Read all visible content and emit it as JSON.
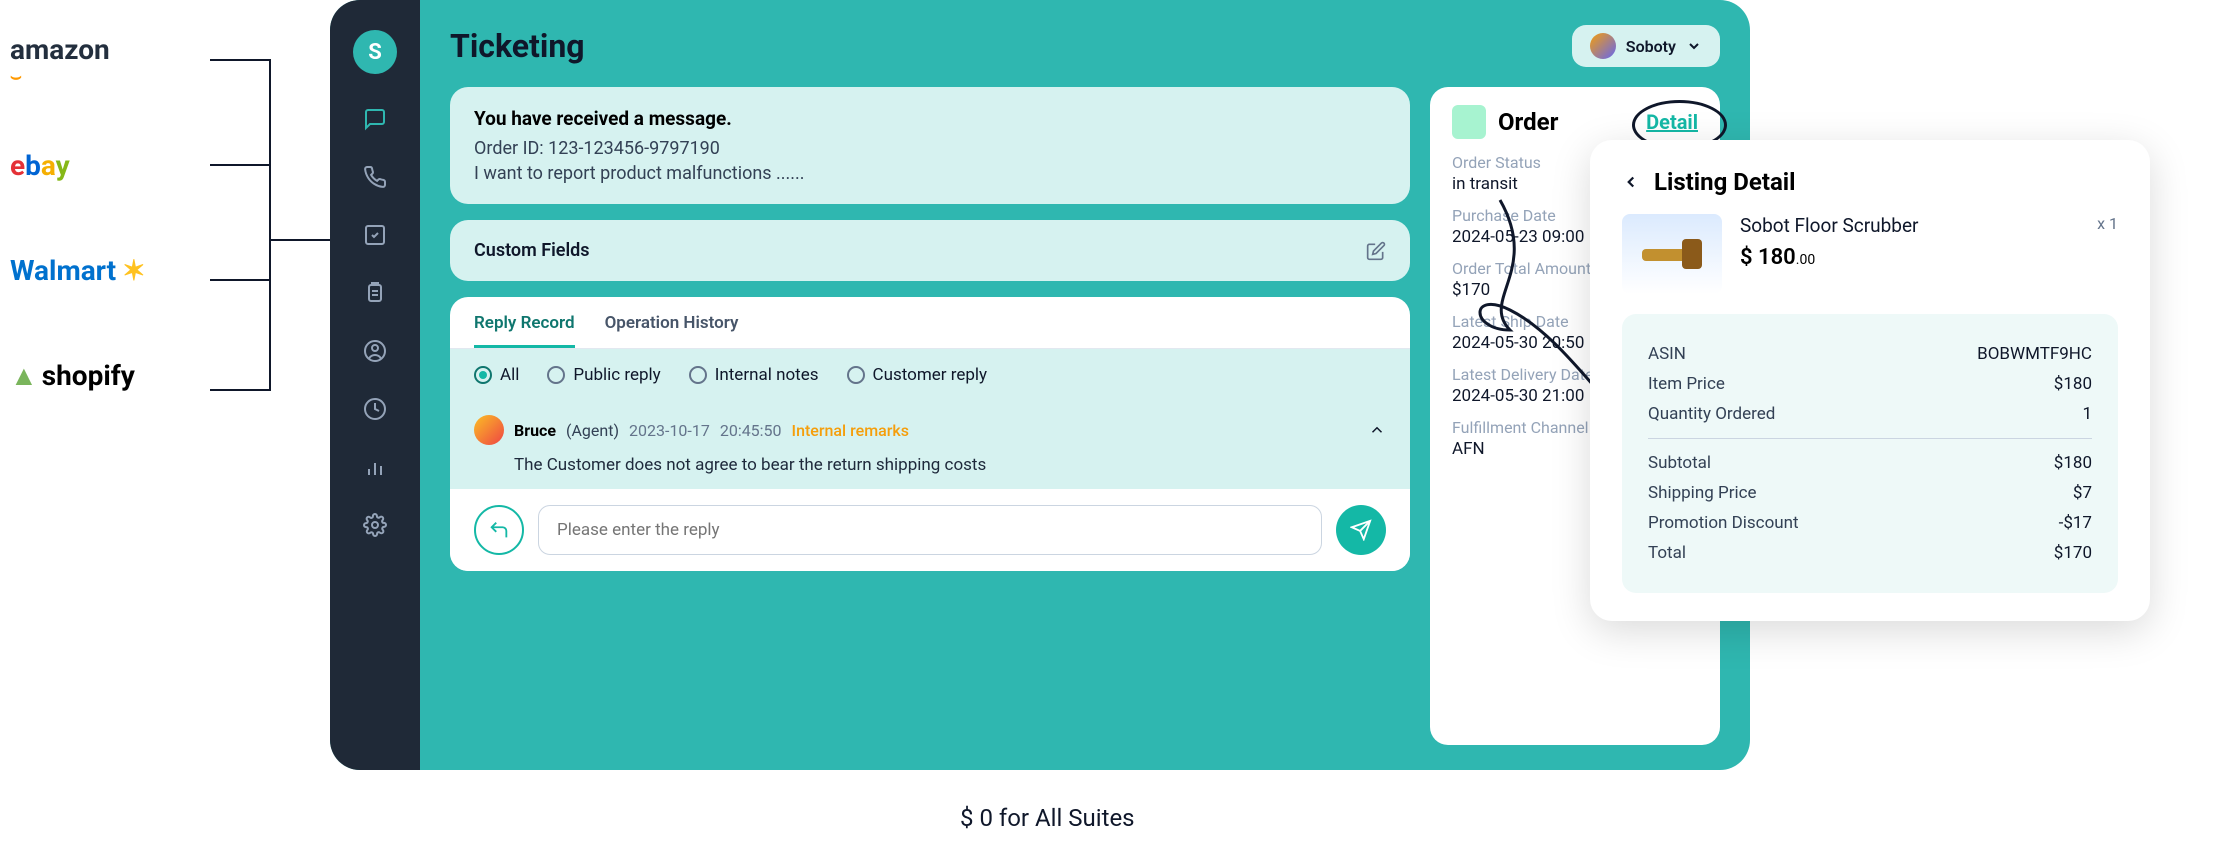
{
  "marketplaces": [
    "amazon",
    "ebay",
    "Walmart",
    "shopify"
  ],
  "header": {
    "title": "Ticketing",
    "brand": "Soboty"
  },
  "message": {
    "title": "You have received a message.",
    "line1": "Order ID: 123-123456-9797190",
    "line2": "I want to report product malfunctions ......"
  },
  "customFields": {
    "title": "Custom Fields"
  },
  "tabs": {
    "reply": "Reply Record",
    "history": "Operation History"
  },
  "filters": {
    "all": "All",
    "public": "Public reply",
    "internal": "Internal notes",
    "customer": "Customer reply"
  },
  "record": {
    "name": "Bruce",
    "role": "(Agent)",
    "date": "2023-10-17",
    "time": "20:45:50",
    "tag": "Internal remarks",
    "body": "The Customer does not agree to bear the return shipping costs"
  },
  "reply": {
    "placeholder": "Please enter the reply"
  },
  "order": {
    "title": "Order",
    "detail": "Detail",
    "fields": {
      "status_l": "Order Status",
      "status_v": "in transit",
      "pdate_l": "Purchase Date",
      "pdate_v": "2024-05-23 09:00",
      "total_l": "Order Total Amount",
      "total_v": "$170",
      "ship_l": "Latest Ship Date",
      "ship_v": "2024-05-30 20:50",
      "deliv_l": "Latest Delivery Date",
      "deliv_v": "2024-05-30 21:00",
      "fulfil_l": "Fulfillment Channel",
      "fulfil_v": "AFN"
    }
  },
  "popover": {
    "title": "Listing Detail",
    "product_name": "Sobot Floor Scrubber",
    "qty": "x 1",
    "price_currency": "$",
    "price_whole": "180",
    "price_cents": ".00",
    "rows": {
      "asin_l": "ASIN",
      "asin_v": "BOBWMTF9HC",
      "item_l": "Item Price",
      "item_v": "$180",
      "qtyo_l": "Quantity Ordered",
      "qtyo_v": "1",
      "sub_l": "Subtotal",
      "sub_v": "$180",
      "ship_l": "Shipping Price",
      "ship_v": "$7",
      "promo_l": "Promotion Discount",
      "promo_v": "-$17",
      "total_l": "Total",
      "total_v": "$170"
    }
  },
  "footer": "$ 0 for All Suites"
}
